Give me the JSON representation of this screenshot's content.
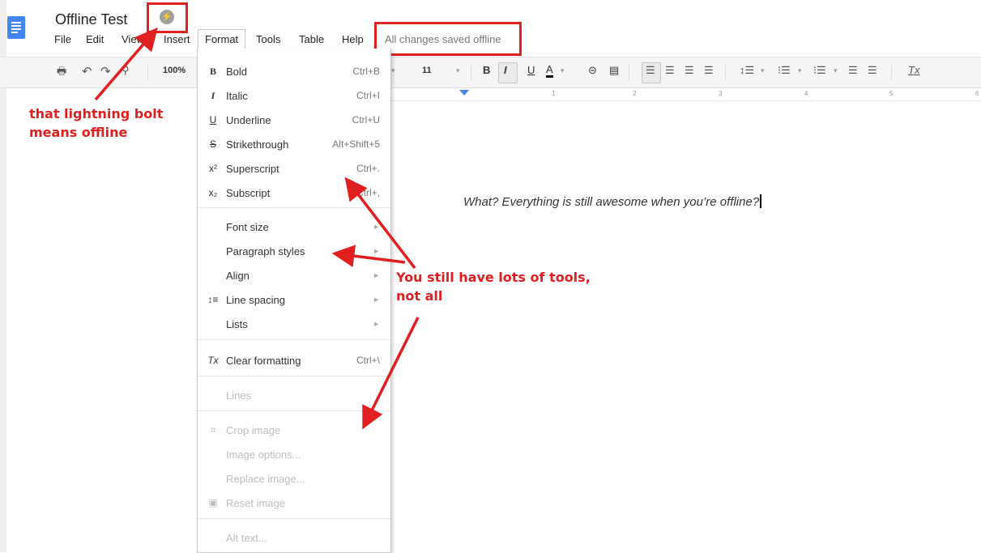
{
  "app": {
    "title": "Offline Test",
    "logo_icon": "docs-logo-icon",
    "offline_icon": "lightning-bolt-icon"
  },
  "menus": [
    "File",
    "Edit",
    "View",
    "Insert",
    "Format",
    "Tools",
    "Table",
    "Help"
  ],
  "active_menu": "Format",
  "save_status": "All changes saved offline",
  "toolbar": {
    "zoom": "100%",
    "font_size": "11",
    "icons": [
      "print-icon",
      "undo-icon",
      "redo-icon",
      "paint-format-icon",
      "bold-icon",
      "italic-icon",
      "underline-icon",
      "text-color-icon",
      "link-icon",
      "comment-icon",
      "align-left-icon",
      "align-center-icon",
      "align-right-icon",
      "justify-icon",
      "line-spacing-icon",
      "numbered-list-icon",
      "bulleted-list-icon",
      "decrease-indent-icon",
      "increase-indent-icon",
      "clear-formatting-icon"
    ]
  },
  "ruler": {
    "numbers": [
      "1",
      "2",
      "3",
      "4",
      "5",
      "6"
    ]
  },
  "format_menu": {
    "items": [
      {
        "icon": "B",
        "label": "Bold",
        "shortcut": "Ctrl+B"
      },
      {
        "icon": "I",
        "label": "Italic",
        "shortcut": "Ctrl+I"
      },
      {
        "icon": "U",
        "label": "Underline",
        "shortcut": "Ctrl+U"
      },
      {
        "icon": "S",
        "label": "Strikethrough",
        "shortcut": "Alt+Shift+5"
      },
      {
        "icon": "x²",
        "label": "Superscript",
        "shortcut": "Ctrl+."
      },
      {
        "icon": "x₂",
        "label": "Subscript",
        "shortcut": "Ctrl+,"
      },
      {
        "label": "Font size"
      },
      {
        "label": "Paragraph styles"
      },
      {
        "label": "Align"
      },
      {
        "icon": "↕≡",
        "label": "Line spacing"
      },
      {
        "label": "Lists"
      },
      {
        "icon": "Tx",
        "label": "Clear formatting",
        "shortcut": "Ctrl+\\"
      },
      {
        "label": "Lines"
      },
      {
        "icon": "⌗",
        "label": "Crop image"
      },
      {
        "label": "Image options..."
      },
      {
        "label": "Replace image..."
      },
      {
        "icon": "▣",
        "label": "Reset image"
      },
      {
        "label": "Alt text..."
      }
    ]
  },
  "document": {
    "text": "What? Everything is still awesome when you’re offline?"
  },
  "annotations": {
    "offline_note": [
      "that lightning bolt",
      "means offline"
    ],
    "tools_note": [
      "You still have lots of tools,",
      "not all"
    ]
  },
  "colors": {
    "accent": "#e02020",
    "brand": "#4285f4"
  }
}
